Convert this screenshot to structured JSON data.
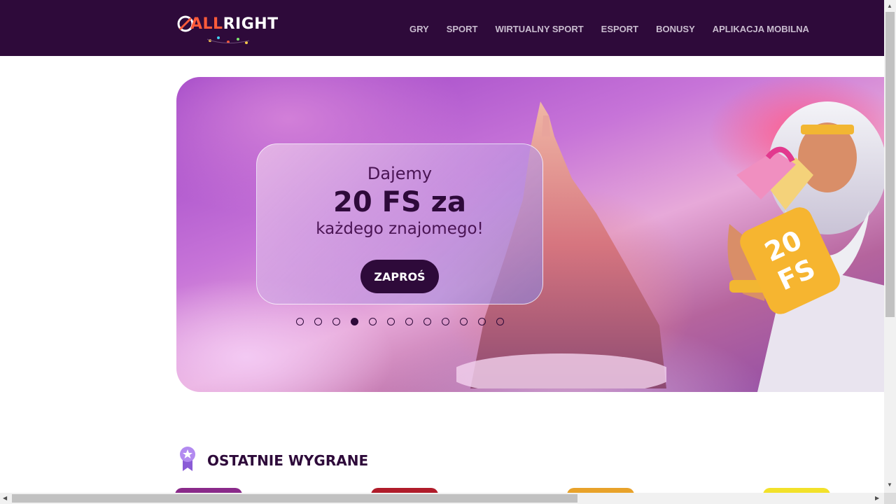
{
  "brand": {
    "logo_text_a": "ALL",
    "logo_text_b": "RIGHT",
    "logo_accent": "#ff5b3a",
    "header_bg": "#2e0a3a"
  },
  "nav": {
    "items": [
      {
        "label": "GRY"
      },
      {
        "label": "SPORT"
      },
      {
        "label": "WIRTUALNY SPORT"
      },
      {
        "label": "ESPORT"
      },
      {
        "label": "BONUSY"
      },
      {
        "label": "APLIKACJA MOBILNA"
      }
    ]
  },
  "hero": {
    "line1": "Dajemy",
    "line2": "20 FS za",
    "line3": "każdego znajomego!",
    "button": "ZAPROŚ",
    "badge": "20 FS",
    "dots_total": 12,
    "dots_active_index": 3
  },
  "wins": {
    "title": "OSTATNIE WYGRANE"
  },
  "icons": {
    "logo": "allright-logo",
    "wins": "medal-star-icon",
    "scroll_up": "arrow-up-icon",
    "scroll_down": "arrow-down-icon",
    "scroll_left": "arrow-left-icon",
    "scroll_right": "arrow-right-icon"
  }
}
